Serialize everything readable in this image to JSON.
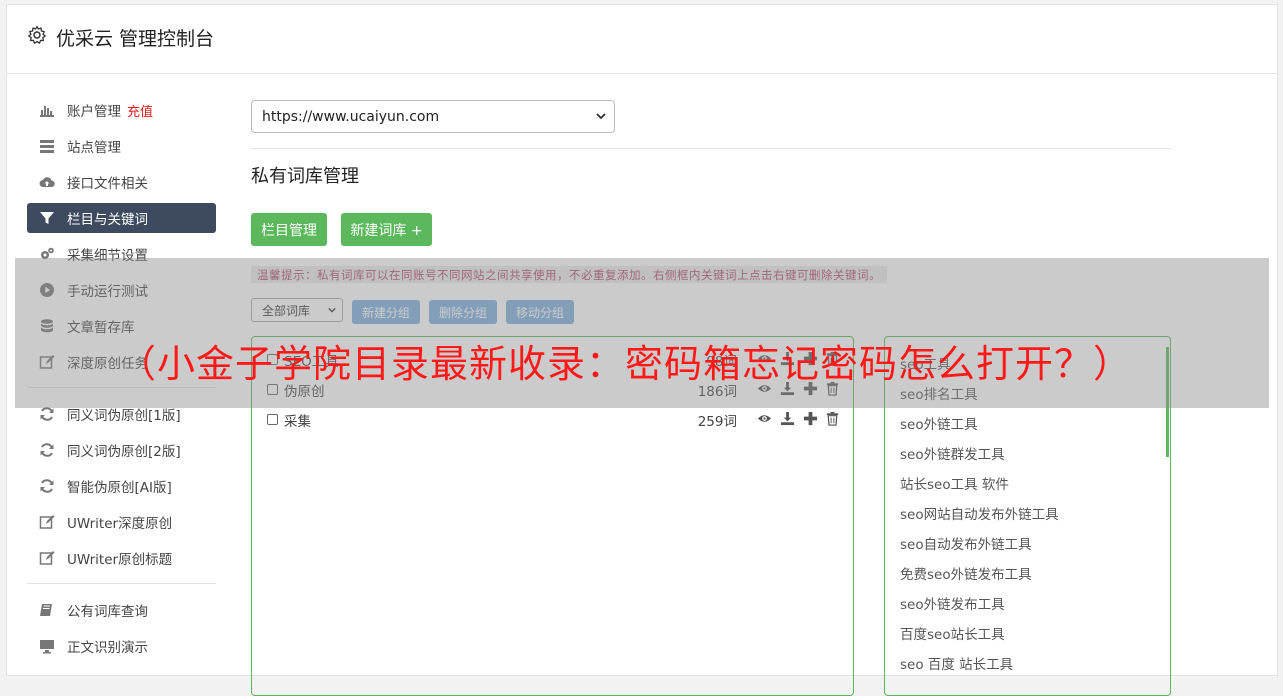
{
  "header": {
    "title": "优采云 管理控制台",
    "icon": "gear-icon"
  },
  "sidebar": {
    "items": [
      {
        "label": "账户管理",
        "badge": "充值",
        "icon": "bar-chart-icon"
      },
      {
        "label": "站点管理",
        "icon": "server-icon"
      },
      {
        "label": "接口文件相关",
        "icon": "cloud-upload-icon"
      },
      {
        "label": "栏目与关键词",
        "icon": "filter-icon",
        "active": true
      },
      {
        "label": "采集细节设置",
        "icon": "cogs-icon"
      },
      {
        "label": "手动运行测试",
        "icon": "play-circle-icon"
      },
      {
        "label": "文章暂存库",
        "icon": "database-icon"
      },
      {
        "label": "深度原创任务",
        "icon": "edit-icon"
      },
      {
        "label": "同义词伪原创[1版]",
        "icon": "refresh-icon"
      },
      {
        "label": "同义词伪原创[2版]",
        "icon": "refresh-icon"
      },
      {
        "label": "智能伪原创[AI版]",
        "icon": "refresh-icon"
      },
      {
        "label": "UWriter深度原创",
        "icon": "edit-icon"
      },
      {
        "label": "UWriter原创标题",
        "icon": "edit-icon"
      },
      {
        "label": "公有词库查询",
        "icon": "book-icon"
      },
      {
        "label": "正文识别演示",
        "icon": "monitor-icon"
      }
    ]
  },
  "main": {
    "site_select": "https://www.ucaiyun.com",
    "section_title": "私有词库管理",
    "btn_columns": "栏目管理",
    "btn_new_library": "新建词库 +",
    "tip": "温馨提示：私有词库可以在同账号不同网站之间共享使用，不必重复添加。右侧框内关键词上点击右键可删除关键词。",
    "library_filter": "全部词库",
    "btn_new_group": "新建分组",
    "btn_delete_group": "删除分组",
    "btn_move_group": "移动分组",
    "libraries": [
      {
        "name": "SEO工具",
        "count": "98词"
      },
      {
        "name": "伪原创",
        "count": "186词"
      },
      {
        "name": "采集",
        "count": "259词"
      }
    ],
    "keywords": [
      "seo工具",
      "seo排名工具",
      "seo外链工具",
      "seo外链群发工具",
      "站长seo工具 软件",
      "seo网站自动发布外链工具",
      "seo自动发布外链工具",
      "免费seo外链发布工具",
      "seo外链发布工具",
      "百度seo站长工具",
      "seo 百度 站长工具"
    ]
  },
  "overlay": {
    "headline": "（小金子学院目录最新收录：密码箱忘记密码怎么打开？）"
  },
  "colors": {
    "accent_green": "#5cb85c",
    "active_nav": "#3e4a60",
    "secondary_button": "#7aaede",
    "badge_red": "#e02020",
    "overlay_text": "#ff1a1a"
  }
}
